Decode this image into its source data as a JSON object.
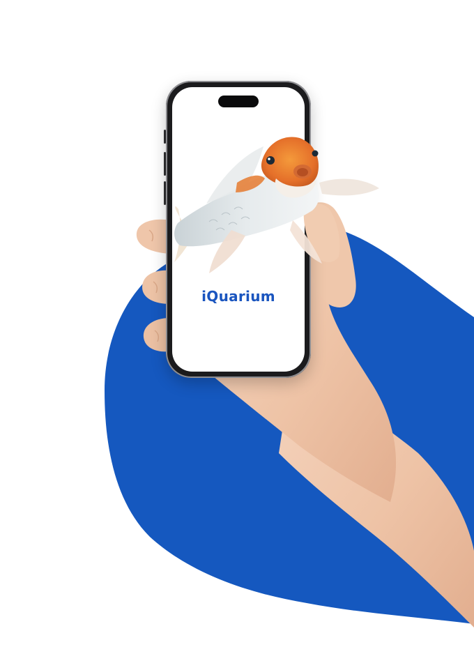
{
  "brand": {
    "logo_text": "iQuarium",
    "logo_prefix": "i",
    "logo_glyph": "Q",
    "logo_suffix": "uarium",
    "logo_color": "#1a55bf"
  },
  "colors": {
    "background": "#ffffff",
    "blob": "#1558bf",
    "skin": "#f0c8ad",
    "phone_frame": "#1b1b1d",
    "koi_orange": "#e9742a"
  },
  "icons": {
    "logo_mark": "wave-q-icon",
    "fish": "koi-fish-image",
    "hand": "hand-image"
  }
}
